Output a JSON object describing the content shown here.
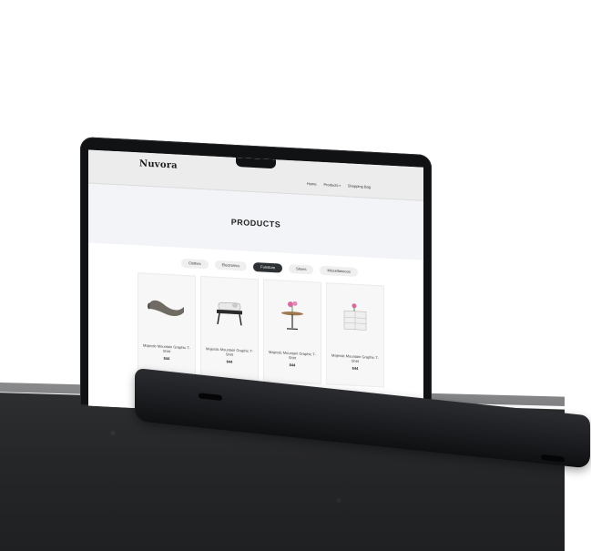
{
  "site": {
    "brand": "Nuvora",
    "nav": [
      {
        "label": "Home"
      },
      {
        "label": "Products"
      },
      {
        "label": "Shopping Bag"
      }
    ]
  },
  "page": {
    "title": "PRODUCTS"
  },
  "filters": [
    {
      "label": "Clothes",
      "active": false
    },
    {
      "label": "Electronics",
      "active": false
    },
    {
      "label": "Furniture",
      "active": true
    },
    {
      "label": "Shoes",
      "active": false
    },
    {
      "label": "Miscellaneous",
      "active": false
    }
  ],
  "products": [
    {
      "name": "Majestic Mountain Graphic T-Shirt",
      "price": "$44",
      "icon": "sofa-icon"
    },
    {
      "name": "Majestic Mountain Graphic T-Shirt",
      "price": "$44",
      "icon": "chair-icon"
    },
    {
      "name": "Majestic Mountain Graphic T-Shirt",
      "price": "$44",
      "icon": "table-icon"
    },
    {
      "name": "Majestic Mountain Graphic T-Shirt",
      "price": "$44",
      "icon": "dresser-icon"
    }
  ]
}
